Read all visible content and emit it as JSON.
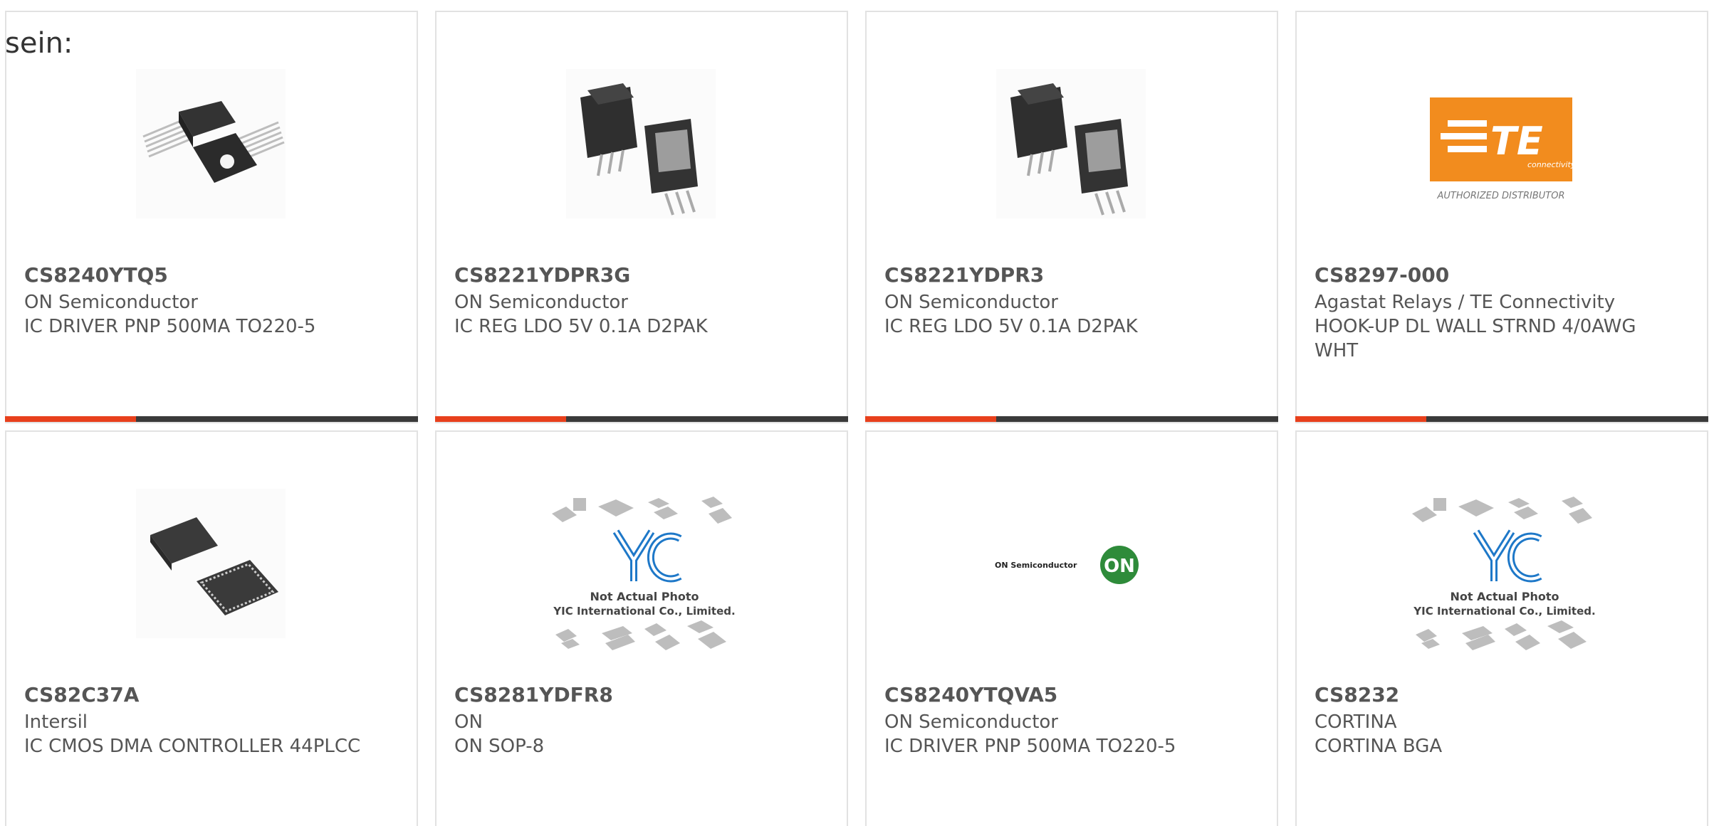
{
  "lead_text": "sein:",
  "products": [
    {
      "part": "CS8240YTQ5",
      "maker": "ON Semiconductor",
      "desc": "IC DRIVER PNP 500MA TO220-5",
      "image_icon": "to220-package-icon"
    },
    {
      "part": "CS8221YDPR3G",
      "maker": "ON Semiconductor",
      "desc": "IC REG LDO 5V 0.1A D2PAK",
      "image_icon": "d2pak-package-icon"
    },
    {
      "part": "CS8221YDPR3",
      "maker": "ON Semiconductor",
      "desc": "IC REG LDO 5V 0.1A D2PAK",
      "image_icon": "d2pak-package-icon"
    },
    {
      "part": "CS8297-000",
      "maker": "Agastat Relays / TE Connectivity",
      "desc": "HOOK-UP DL WALL STRND 4/0AWG WHT",
      "image_icon": "te-connectivity-logo"
    },
    {
      "part": "CS82C37A",
      "maker": "Intersil",
      "desc": "IC CMOS DMA CONTROLLER 44PLCC",
      "image_icon": "plcc-package-icon"
    },
    {
      "part": "CS8281YDFR8",
      "maker": "ON",
      "desc": "ON SOP-8",
      "image_icon": "yic-placeholder-image"
    },
    {
      "part": "CS8240YTQVA5",
      "maker": "ON Semiconductor",
      "desc": "IC DRIVER PNP 500MA TO220-5",
      "image_icon": "on-semiconductor-logo"
    },
    {
      "part": "CS8232",
      "maker": "CORTINA",
      "desc": "CORTINA BGA",
      "image_icon": "yic-placeholder-image"
    }
  ],
  "logos": {
    "te_word": "TE",
    "te_sub": "connectivity",
    "te_authorized": "AUTHORIZED DISTRIBUTOR",
    "on_word": "ON Semiconductor",
    "on_mark": "ON",
    "yic_mark": "YIC",
    "yic_line1": "Not Actual Photo",
    "yic_line2": "YIC International Co., Limited."
  },
  "colors": {
    "accent": "#e8401c",
    "bar": "#3a3a3a",
    "te_orange": "#f28c1e",
    "on_green": "#2e8b3a",
    "yic_blue": "#1e78c8"
  }
}
